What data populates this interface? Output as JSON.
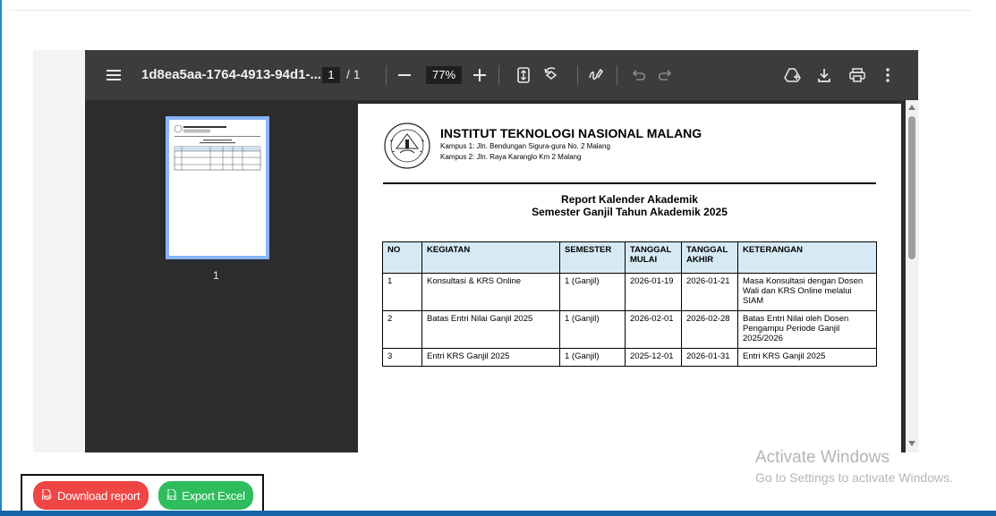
{
  "viewer": {
    "title": "1d8ea5aa-1764-4913-94d1-...",
    "current_page": "1",
    "page_separator": "/ 1",
    "zoom": "77%",
    "thumbnail_label": "1"
  },
  "document": {
    "institution": "INSTITUT TEKNOLOGI NASIONAL MALANG",
    "campus1": "Kampus 1: Jln. Bendungan Sigura-gura No. 2 Malang",
    "campus2": "Kampus 2: Jln. Raya Karanglo Km 2 Malang",
    "report_title": "Report Kalender Akademik",
    "report_subtitle": "Semester Ganjil Tahun Akademik 2025",
    "table": {
      "headers": [
        "NO",
        "KEGIATAN",
        "SEMESTER",
        "TANGGAL MULAI",
        "TANGGAL AKHIR",
        "KETERANGAN"
      ],
      "rows": [
        [
          "1",
          "Konsultasi & KRS Online",
          "1 (Ganjil)",
          "2026-01-19",
          "2026-01-21",
          "Masa Konsultasi dengan Dosen Wali dan KRS Online melalui SIAM"
        ],
        [
          "2",
          "Batas Entri Nilai Ganjil 2025",
          "1 (Ganjil)",
          "2026-02-01",
          "2026-02-28",
          "Batas Entri Nilai oleh Dosen Pengampu Periode Ganjil 2025/2026"
        ],
        [
          "3",
          "Entri KRS Ganjil 2025",
          "1 (Ganjil)",
          "2025-12-01",
          "2026-01-31",
          "Entri KRS Ganjil 2025"
        ]
      ]
    }
  },
  "watermark": {
    "line1": "Activate Windows",
    "line2": "Go to Settings to activate Windows."
  },
  "actions": {
    "download_label": "Download report",
    "download_icon_text": "PDF",
    "export_label": "Export Excel",
    "export_icon_text": "XLS"
  },
  "colors": {
    "download": "#f04545",
    "export": "#2ebd5d",
    "toolbar": "#3c3c3c",
    "header_fill": "#d6eaf5"
  },
  "icons": [
    "menu-icon",
    "zoom-out-icon",
    "zoom-in-icon",
    "fit-page-icon",
    "rotate-icon",
    "annotate-icon",
    "undo-icon",
    "redo-icon",
    "add-to-drive-icon",
    "download-icon",
    "print-icon",
    "more-icon"
  ]
}
